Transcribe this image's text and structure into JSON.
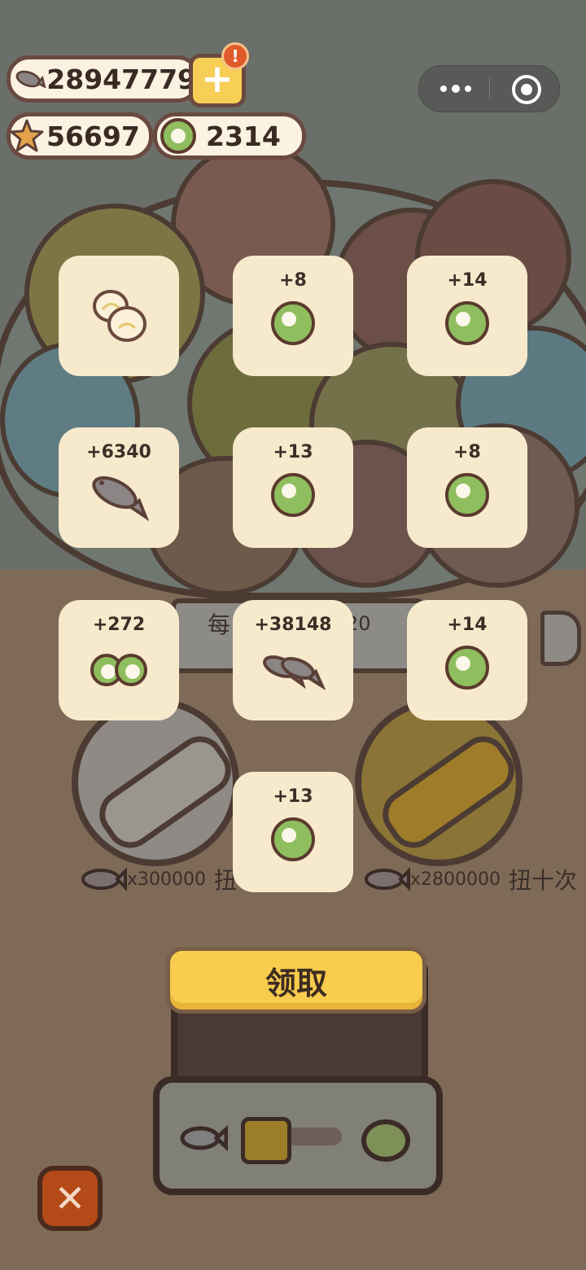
{
  "currency": {
    "fish": "28947779",
    "stars": "56697",
    "coins": "2314"
  },
  "alert_badge": "!",
  "plus_label": "+",
  "background": {
    "jar_label_prefix": "每",
    "jar_label_suffix": "20",
    "single_spin": {
      "cost": "x300000",
      "label": "扭一次"
    },
    "ten_spin": {
      "cost": "x2800000",
      "label": "扭十次"
    }
  },
  "rewards": [
    {
      "amount": "",
      "icon": "egg-icon"
    },
    {
      "amount": "+8",
      "icon": "coin-icon"
    },
    {
      "amount": "+14",
      "icon": "coin-icon"
    },
    {
      "amount": "+6340",
      "icon": "fish-icon"
    },
    {
      "amount": "+13",
      "icon": "coin-icon"
    },
    {
      "amount": "+8",
      "icon": "coin-icon"
    },
    {
      "amount": "+272",
      "icon": "two-coins-icon"
    },
    {
      "amount": "+38148",
      "icon": "two-fish-icon"
    },
    {
      "amount": "+14",
      "icon": "coin-icon"
    },
    {
      "amount": "+13",
      "icon": "coin-icon"
    }
  ],
  "claim_label": "领取",
  "close_label": "✕",
  "colors": {
    "card": "#f7e9cc",
    "claim_button": "#f8cc4c",
    "close_button": "#b44a17",
    "coin_green": "#8fbe5e"
  }
}
